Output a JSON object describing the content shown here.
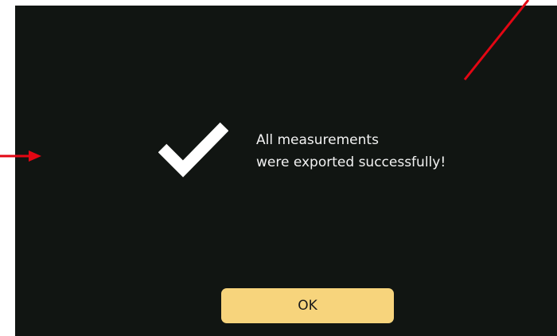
{
  "dialog": {
    "message_line1": "All measurements",
    "message_line2": "were exported successfully!",
    "ok_label": "OK",
    "check_icon": "checkmark-icon"
  },
  "colors": {
    "dialog_background": "#111512",
    "button_background": "#f7d47c",
    "message_text": "#f2f2f2",
    "annotation": "#e30613"
  }
}
